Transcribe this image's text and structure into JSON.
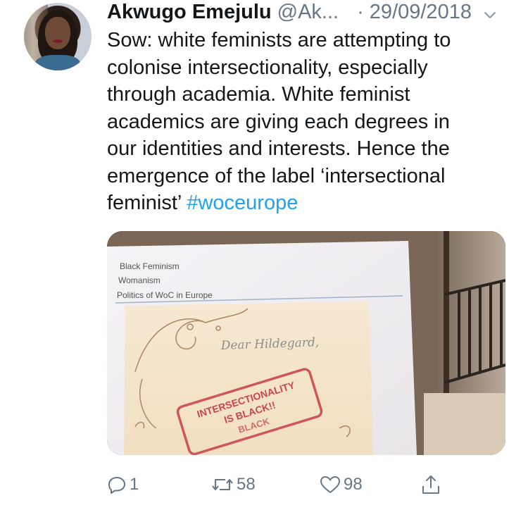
{
  "author": {
    "name": "Akwugo Emejulu",
    "handle": "@Ak...",
    "date": "· 29/09/2018"
  },
  "tweet": {
    "text_lines": [
      "Sow: white feminists are attempting to",
      "colonise intersectionality, especially",
      "through academia. White feminist",
      "academics are giving each degrees in",
      "our identities and interests. Hence the",
      "emergence of the label ‘intersectional"
    ],
    "last_line_text": "feminist’ ",
    "hashtag": "#woceurope"
  },
  "media": {
    "slide_lines": [
      "Black Feminism",
      "Womanism",
      "Politics of WoC in Europe"
    ],
    "letter_greeting": "Dear Hildegard,",
    "stamp_lines": [
      "INTERSECTIONALITY",
      "IS BLACK!!",
      "BLACK"
    ]
  },
  "actions": {
    "reply_count": "1",
    "retweet_count": "58",
    "like_count": "98"
  },
  "colors": {
    "hashtag": "#1da1f2",
    "secondary_text": "#657786",
    "stamp_red": "#c8474f"
  },
  "icons": [
    "chevron-down-icon",
    "reply-icon",
    "retweet-icon",
    "like-icon",
    "share-icon"
  ]
}
